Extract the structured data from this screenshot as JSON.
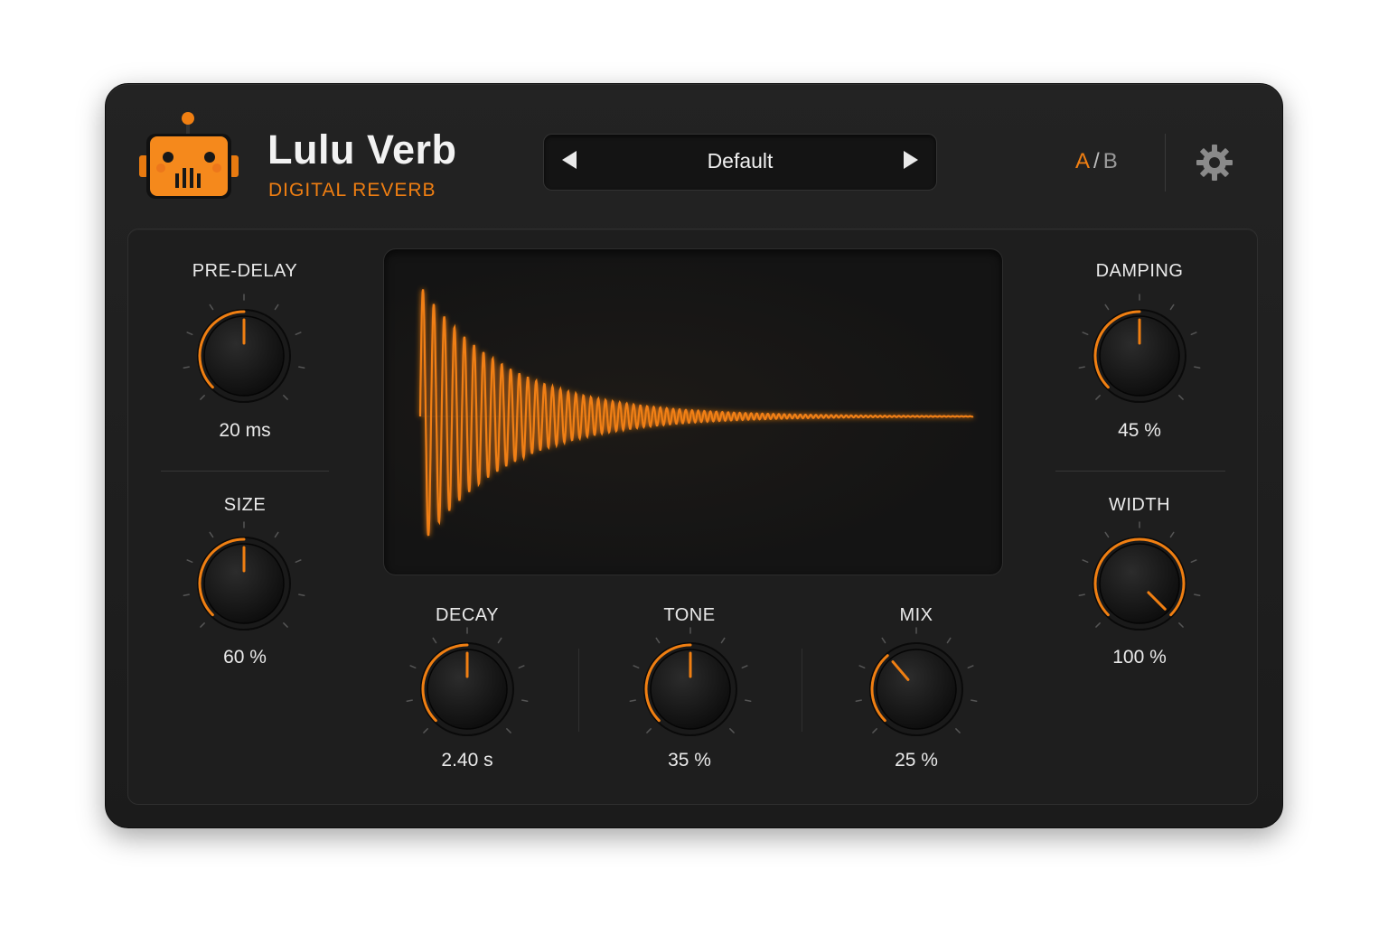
{
  "app": {
    "title": "Lulu Verb",
    "subtitle": "DIGITAL REVERB",
    "accent_color": "#f07f12"
  },
  "preset": {
    "name": "Default",
    "prev_icon": "triangle-left-icon",
    "next_icon": "triangle-right-icon"
  },
  "ab": {
    "a": "A",
    "sep": "/",
    "b": "B",
    "active": "A"
  },
  "settings": {
    "icon": "gear-icon"
  },
  "knobs": {
    "predelay": {
      "label": "PRE-DELAY",
      "value": "20 ms",
      "level": 0.5
    },
    "size": {
      "label": "SIZE",
      "value": "60 %",
      "level": 0.5
    },
    "damping": {
      "label": "DAMPING",
      "value": "45 %",
      "level": 0.5
    },
    "width": {
      "label": "WIDTH",
      "value": "100 %",
      "level": 1.0
    },
    "decay": {
      "label": "DECAY",
      "value": "2.40 s",
      "level": 0.5
    },
    "tone": {
      "label": "TONE",
      "value": "35 %",
      "level": 0.5
    },
    "mix": {
      "label": "MIX",
      "value": "25 %",
      "level": 0.35
    }
  }
}
